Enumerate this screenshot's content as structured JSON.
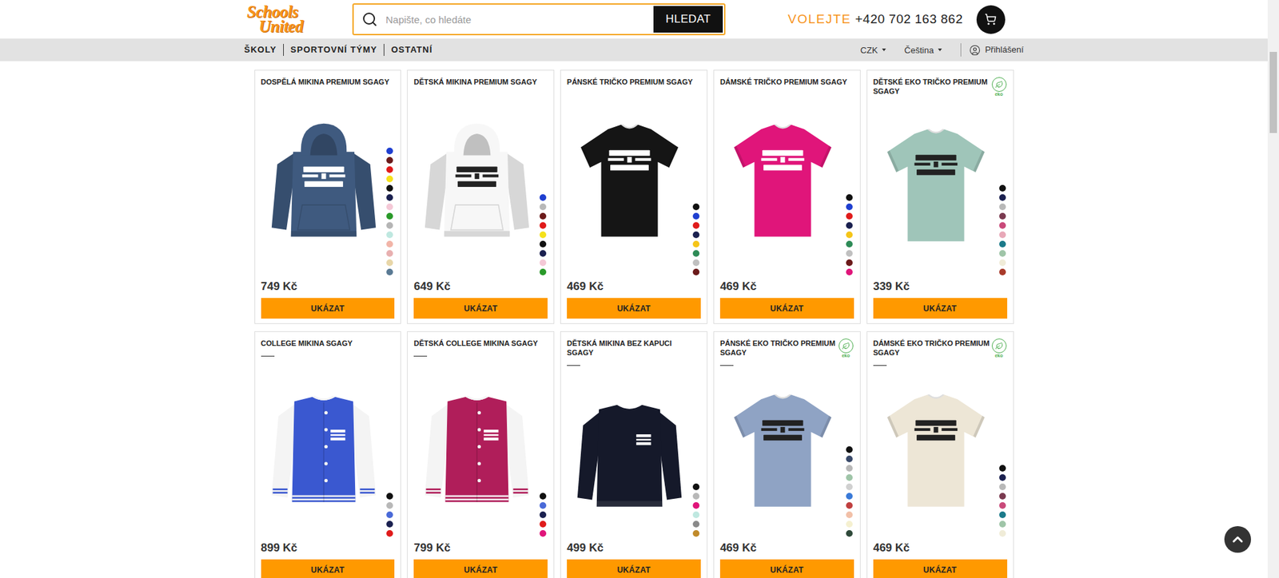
{
  "header": {
    "logo": {
      "line1": "Schools",
      "line2": "United"
    },
    "search": {
      "placeholder": "Napište, co hledáte",
      "button": "HLEDAT"
    },
    "phone": {
      "label": "VOLEJTE",
      "number": "+420 702 163 862"
    }
  },
  "nav": {
    "items": [
      "ŠKOLY",
      "SPORTOVNÍ TÝMY",
      "OSTATNÍ"
    ],
    "currency": "CZK",
    "language": "Čeština",
    "login": "Přihlášení"
  },
  "eco_label": "eko",
  "products": [
    {
      "title": "DOSPĚLÁ MIKINA PREMIUM SGAGY",
      "price": "749 Kč",
      "button": "UKÁZAT",
      "kind": "hoodie",
      "color": "#3f5a7f",
      "trim": "#3f5a7f",
      "eco": false,
      "divider": false,
      "swatches": [
        "#1f3fd0",
        "#6b1a1a",
        "#e01b1b",
        "#f5e11b",
        "#111111",
        "#1b2150",
        "#f4c8d6",
        "#2a9a2a",
        "#b5b5b5",
        "#bfe8e0",
        "#f2b5a8",
        "#e8b0b0",
        "#e8d6a8",
        "#5a7a94"
      ]
    },
    {
      "title": "DĚTSKÁ MIKINA PREMIUM SGAGY",
      "price": "649 Kč",
      "button": "UKÁZAT",
      "kind": "hoodie",
      "color": "#f7f7f7",
      "trim": "#f7f7f7",
      "eco": false,
      "divider": false,
      "swatches": [
        "#1f3fd0",
        "#b8b8b8",
        "#6b1a1a",
        "#e01b1b",
        "#f5e11b",
        "#111111",
        "#1b2150",
        "#f4c8d6",
        "#2a9a2a"
      ]
    },
    {
      "title": "PÁNSKÉ TRIČKO PREMIUM SGAGY",
      "price": "469 Kč",
      "button": "UKÁZAT",
      "kind": "tshirt",
      "color": "#151515",
      "trim": "#151515",
      "eco": false,
      "divider": false,
      "swatches": [
        "#111111",
        "#1f3fd0",
        "#e01b1b",
        "#1b2150",
        "#f5c518",
        "#2e8b57",
        "#c0c0c0",
        "#6b1a1a"
      ]
    },
    {
      "title": "DÁMSKÉ TRIČKO PREMIUM SGAGY",
      "price": "469 Kč",
      "button": "UKÁZAT",
      "kind": "tshirt",
      "color": "#e0157a",
      "trim": "#e0157a",
      "eco": false,
      "divider": false,
      "swatches": [
        "#111111",
        "#1f3fd0",
        "#e01b1b",
        "#1b2150",
        "#f5c518",
        "#2e8b57",
        "#c0c0c0",
        "#6b1a1a",
        "#e0157a"
      ]
    },
    {
      "title": "DĚTSKÉ EKO TRIČKO PREMIUM SGAGY",
      "price": "339 Kč",
      "button": "UKÁZAT",
      "kind": "tshirt",
      "color": "#9fc5b9",
      "trim": "#9fc5b9",
      "eco": true,
      "divider": false,
      "swatches": [
        "#111111",
        "#1b2150",
        "#b8b8b8",
        "#7a3a50",
        "#c94a7a",
        "#e8a8b8",
        "#1b7a8a",
        "#9fc5a8",
        "#f0ecd8",
        "#a83a2a"
      ]
    },
    {
      "title": "COLLEGE MIKINA SGAGY",
      "price": "899 Kč",
      "button": "UKÁZAT",
      "kind": "college",
      "color": "#3a58d0",
      "trim": "#f4f4f4",
      "eco": false,
      "divider": true,
      "swatches": [
        "#111111",
        "#b8b8b8",
        "#4a6ad8",
        "#1b2150",
        "#e01b1b"
      ]
    },
    {
      "title": "DĚTSKÁ COLLEGE MIKINA SGAGY",
      "price": "799 Kč",
      "button": "UKÁZAT",
      "kind": "college",
      "color": "#b01e5a",
      "trim": "#f4f4f4",
      "eco": false,
      "divider": true,
      "swatches": [
        "#111111",
        "#4a6ad8",
        "#1b2150",
        "#e01b1b",
        "#e0157a"
      ]
    },
    {
      "title": "DĚTSKÁ MIKINA BEZ KAPUCI SGAGY",
      "price": "499 Kč",
      "button": "UKÁZAT",
      "kind": "sweatshirt",
      "color": "#15192a",
      "trim": "#15192a",
      "eco": false,
      "divider": true,
      "swatches": [
        "#111111",
        "#b8b8b8",
        "#e0157a",
        "#bfe8e0",
        "#8a8a8a",
        "#c08a2a"
      ]
    },
    {
      "title": "PÁNSKÉ EKO TRIČKO PREMIUM SGAGY",
      "price": "469 Kč",
      "button": "UKÁZAT",
      "kind": "tshirt",
      "color": "#8fa3c4",
      "trim": "#8fa3c4",
      "eco": true,
      "divider": true,
      "swatches": [
        "#111111",
        "#3a4a6a",
        "#b8b8b8",
        "#9fc5a8",
        "#d0d0d0",
        "#3a7ad8",
        "#c04040",
        "#f2c0a8",
        "#f5f0d0",
        "#2f4a3a"
      ]
    },
    {
      "title": "DÁMSKÉ EKO TRIČKO PREMIUM SGAGY",
      "price": "469 Kč",
      "button": "UKÁZAT",
      "kind": "tshirt",
      "color": "#ede6d6",
      "trim": "#ede6d6",
      "eco": true,
      "divider": true,
      "swatches": [
        "#111111",
        "#1b2150",
        "#b8b8b8",
        "#7a3a50",
        "#c94a7a",
        "#1b7a8a",
        "#9fc5a8",
        "#f0ecd8"
      ]
    }
  ],
  "scrollbar": {
    "offset": 0.09,
    "thumb": 0.14
  }
}
